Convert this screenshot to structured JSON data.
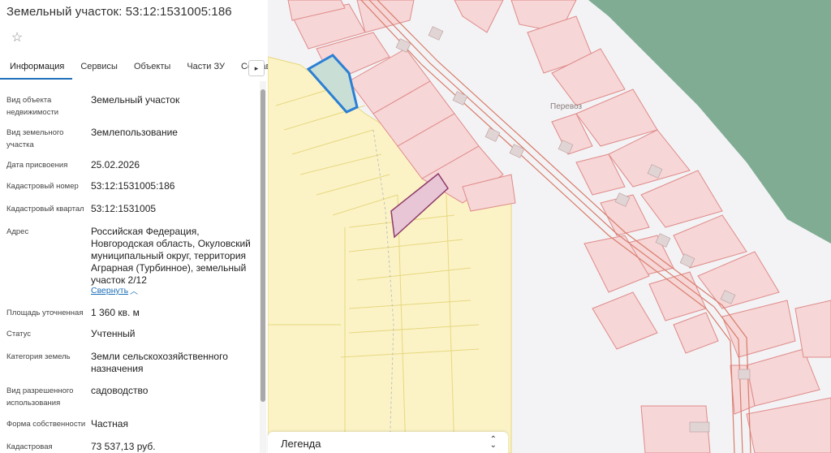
{
  "panel": {
    "title": "Земельный участок: 53:12:1531005:186"
  },
  "tabs": [
    {
      "label": "Информация"
    },
    {
      "label": "Сервисы"
    },
    {
      "label": "Объекты"
    },
    {
      "label": "Части ЗУ"
    },
    {
      "label": "Состав"
    }
  ],
  "tab_scroll_glyph": "▸",
  "properties": [
    {
      "label": "Вид объекта недвижимости",
      "value": "Земельный участок"
    },
    {
      "label": "Вид земельного участка",
      "value": "Землепользование"
    },
    {
      "label": "Дата присвоения",
      "value": "25.02.2026"
    },
    {
      "label": "Кадастровый номер",
      "value": "53:12:1531005:186"
    },
    {
      "label": "Кадастровый квартал",
      "value": "53:12:1531005"
    },
    {
      "label": "Адрес",
      "value": "Российская Федерация, Новгородская область, Окуловский муниципальный округ, территория Аграрная (Турбинное), земельный участок 2/12"
    },
    {
      "label": "Площадь уточненная",
      "value": "1 360 кв. м"
    },
    {
      "label": "Статус",
      "value": "Учтенный"
    },
    {
      "label": "Категория земель",
      "value": "Земли сельскохозяйственного назначения"
    },
    {
      "label": "Вид разрешенного использования",
      "value": "садоводство"
    },
    {
      "label": "Форма собственности",
      "value": "Частная"
    },
    {
      "label": "Кадастровая",
      "value": "73 537,13 руб."
    }
  ],
  "address_collapse": {
    "label": "Свернуть",
    "icon": "chevron-up-icon"
  },
  "map": {
    "village_label": "Перевоз",
    "colors": {
      "water": "#7fac93",
      "parcel_fill": "#f6d6d6",
      "parcel_stroke": "#e08a8a",
      "agri_fill": "#fbf3c6",
      "agri_stroke": "#e7d77f",
      "selected_fill": "#c9dfd6",
      "selected_stroke": "#2b7fd4",
      "highlight_fill": "#e8c6d6",
      "highlight_stroke": "#8e3a6b",
      "road": "#d87d6b"
    }
  },
  "legend": {
    "label": "Легенда",
    "icon": "chevron-up-down-icon"
  },
  "icons": {
    "star": "star-icon"
  }
}
